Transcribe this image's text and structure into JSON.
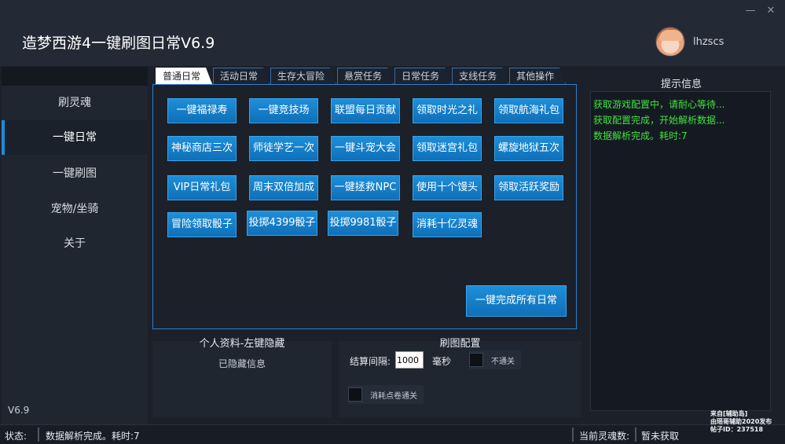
{
  "window": {
    "title": "造梦西游4一键刷图日常V6.9",
    "minimize_glyph": "—",
    "close_glyph": "✕",
    "username": "lhzscs"
  },
  "sidebar": {
    "items": [
      {
        "label": "刷灵魂"
      },
      {
        "label": "一键日常"
      },
      {
        "label": "一键刷图"
      },
      {
        "label": "宠物/坐骑"
      },
      {
        "label": "关于"
      }
    ],
    "active_index": 1,
    "version": "V6.9"
  },
  "tabs": [
    {
      "label": "普通日常"
    },
    {
      "label": "活动日常"
    },
    {
      "label": "生存大冒险"
    },
    {
      "label": "悬赏任务"
    },
    {
      "label": "日常任务"
    },
    {
      "label": "支线任务"
    },
    {
      "label": "其他操作"
    }
  ],
  "active_tab": 0,
  "actions": [
    [
      "一键福禄寿",
      "一键竞技场",
      "联盟每日贡献",
      "领取时光之礼",
      "领取航海礼包"
    ],
    [
      "神秘商店三次",
      "师徒学艺一次",
      "一键斗宠大会",
      "领取迷宫礼包",
      "螺旋地狱五次"
    ],
    [
      "VIP日常礼包",
      "周末双倍加成",
      "一键拯救NPC",
      "使用十个馒头",
      "领取活跃奖励"
    ],
    [
      "冒险领取骰子",
      "投掷4399骰子",
      "投掷9981骰子",
      "消耗十亿灵魂"
    ]
  ],
  "complete_all_label": "一键完成所有日常",
  "info": {
    "title": "提示信息",
    "lines": [
      "获取游戏配置中，请耐心等待...",
      "获取配置完成，开始解析数据...",
      "数据解析完成。耗时:7"
    ],
    "text_color": "#3fe23f"
  },
  "profile": {
    "title": "个人资料-左键隐藏",
    "hidden_text": "已隐藏信息"
  },
  "config": {
    "title": "刷图配置",
    "interval_label": "结算间隔:",
    "interval_value": "1000",
    "ms_label": "毫秒",
    "no_clear_label": "不通关",
    "use_ticket_label": "消耗点卷通关"
  },
  "status": {
    "label": "状态:",
    "message": "数据解析完成。耗时:7",
    "soul_label": "当前灵魂数:",
    "soul_value": "暂未获取"
  },
  "watermark": {
    "line1": "来自[辅助岛]",
    "line2": "由瑶哥辅助2020发布",
    "line3": "帖子ID：237518"
  },
  "colors": {
    "accent": "#1f8bd6",
    "button": "#1580c9",
    "background": "#1b2029"
  }
}
